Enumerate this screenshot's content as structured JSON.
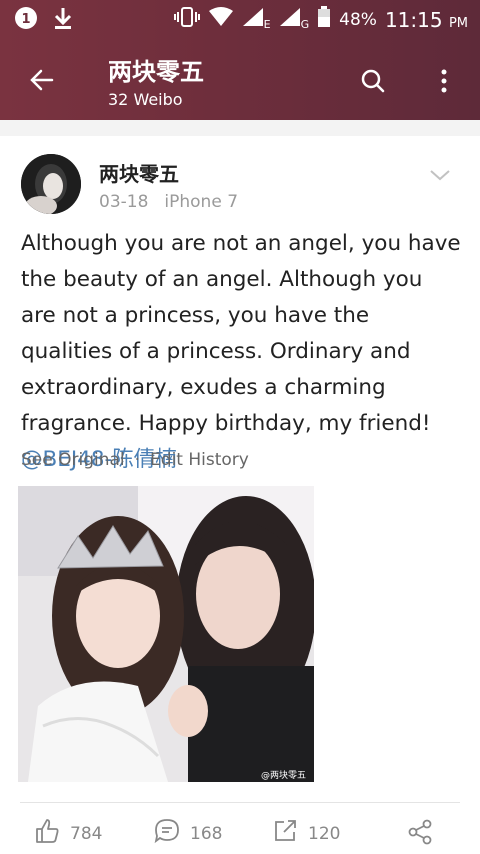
{
  "status_bar": {
    "battery": "48%",
    "time": "11:15",
    "ampm": "PM",
    "net_e": "E",
    "net_g": "G"
  },
  "header": {
    "title": "两块零五",
    "subtitle": "32 Weibo"
  },
  "post": {
    "author": "两块零五",
    "date": "03-18",
    "device": "iPhone 7",
    "text": "Although you are not an angel, you have the beauty of an angel. Although you are not a princess, you have the qualities of a princess. Ordinary and extraordinary, exudes a charming fragrance. Happy birthday, my friend! ",
    "mention": "@BEJ48-陈倩楠",
    "see_original": "See Original",
    "separator": "·",
    "edit_history": "Edit History",
    "photo_watermark": "@两块零五"
  },
  "actions": {
    "likes": "784",
    "comments": "168",
    "reposts": "120"
  },
  "colors": {
    "appbar": "#6e2e3c",
    "mention": "#4a7fb5",
    "meta": "#9a9a9a"
  }
}
